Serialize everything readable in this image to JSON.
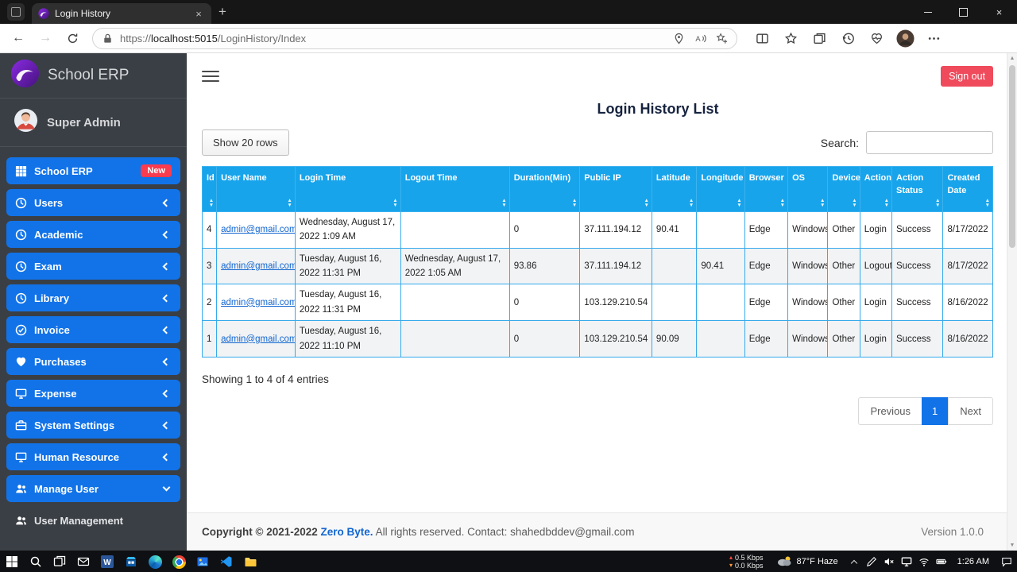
{
  "theme": {
    "primary_blue": "#1273e8",
    "table_header_blue": "#17a4eb",
    "signout_red": "#ef4b5c",
    "badge_red": "#fb3b4e",
    "sidebar_bg": "#3a3f45",
    "link_blue": "#1266d0",
    "taskbar_bg": "#0f1013"
  },
  "icons": {
    "close": "×",
    "new_tab": "+",
    "back": "←",
    "forward": "→",
    "sort_up": "▲",
    "sort_down": "▼",
    "net_up_arrow": "▴",
    "net_down_arrow": "▾"
  },
  "browser": {
    "tab_title": "Login History",
    "url_scheme": "https://",
    "url_host": "localhost:5015",
    "url_path": "/LoginHistory/Index"
  },
  "sidebar": {
    "brand": "School ERP",
    "user": "Super Admin",
    "items": [
      {
        "label": "School ERP",
        "icon": "grid-icon",
        "badge": "New"
      },
      {
        "label": "Users",
        "icon": "clock-icon",
        "chevron": "left"
      },
      {
        "label": "Academic",
        "icon": "clock-icon",
        "chevron": "left"
      },
      {
        "label": "Exam",
        "icon": "clock-icon",
        "chevron": "left"
      },
      {
        "label": "Library",
        "icon": "clock-icon",
        "chevron": "left"
      },
      {
        "label": "Invoice",
        "icon": "check-circle-icon",
        "chevron": "left"
      },
      {
        "label": "Purchases",
        "icon": "heart-icon",
        "chevron": "left"
      },
      {
        "label": "Expense",
        "icon": "monitor-icon",
        "chevron": "left"
      },
      {
        "label": "System Settings",
        "icon": "briefcase-icon",
        "chevron": "left"
      },
      {
        "label": "Human Resource",
        "icon": "monitor-icon",
        "chevron": "left"
      },
      {
        "label": "Manage User",
        "icon": "users-icon",
        "chevron": "down"
      },
      {
        "label": "User Management",
        "icon": "users-icon",
        "plain": true
      }
    ]
  },
  "topbar": {
    "signout_label": "Sign out"
  },
  "main": {
    "title": "Login History List",
    "show_rows_label": "Show 20 rows",
    "search_label": "Search:",
    "summary": "Showing 1 to 4 of 4 entries",
    "pagination": {
      "previous": "Previous",
      "current_page": "1",
      "next": "Next"
    }
  },
  "table": {
    "headers": [
      "Id",
      "User Name",
      "Login Time",
      "Logout Time",
      "Duration(Min)",
      "Public IP",
      "Latitude",
      "Longitude",
      "Browser",
      "OS",
      "Device",
      "Action",
      "Action Status",
      "Created Date"
    ],
    "rows": [
      [
        "4",
        "admin@gmail.com",
        "Wednesday, August 17, 2022 1:09 AM",
        "",
        "0",
        "37.111.194.12",
        "90.41",
        "",
        "Edge",
        "Windows",
        "Other",
        "Login",
        "Success",
        "8/17/2022"
      ],
      [
        "3",
        "admin@gmail.com",
        "Tuesday, August 16, 2022 11:31 PM",
        "Wednesday, August 17, 2022 1:05 AM",
        "93.86",
        "37.111.194.12",
        "",
        "90.41",
        "Edge",
        "Windows",
        "Other",
        "Logout",
        "Success",
        "8/17/2022"
      ],
      [
        "2",
        "admin@gmail.com",
        "Tuesday, August 16, 2022 11:31 PM",
        "",
        "0",
        "103.129.210.54",
        "",
        "",
        "Edge",
        "Windows",
        "Other",
        "Login",
        "Success",
        "8/16/2022"
      ],
      [
        "1",
        "admin@gmail.com",
        "Tuesday, August 16, 2022 11:10 PM",
        "",
        "0",
        "103.129.210.54",
        "90.09",
        "",
        "Edge",
        "Windows",
        "Other",
        "Login",
        "Success",
        "8/16/2022"
      ]
    ]
  },
  "footer": {
    "copyright_bold": "Copyright © 2021-2022",
    "brand": "Zero Byte.",
    "rest": "All rights reserved. Contact: shahedbddev@gmail.com",
    "version": "Version 1.0.0"
  },
  "taskbar": {
    "apps": [
      "start",
      "search",
      "task-view",
      "mail",
      "word",
      "store",
      "edge",
      "chrome",
      "photos",
      "vscode",
      "file-explorer"
    ],
    "net_up": "0.5 Kbps",
    "net_down": "0.0 Kbps",
    "weather": "87°F Haze",
    "time": "1:26 AM",
    "tray": [
      "pen",
      "volume-mute",
      "monitor",
      "wifi",
      "battery"
    ]
  }
}
